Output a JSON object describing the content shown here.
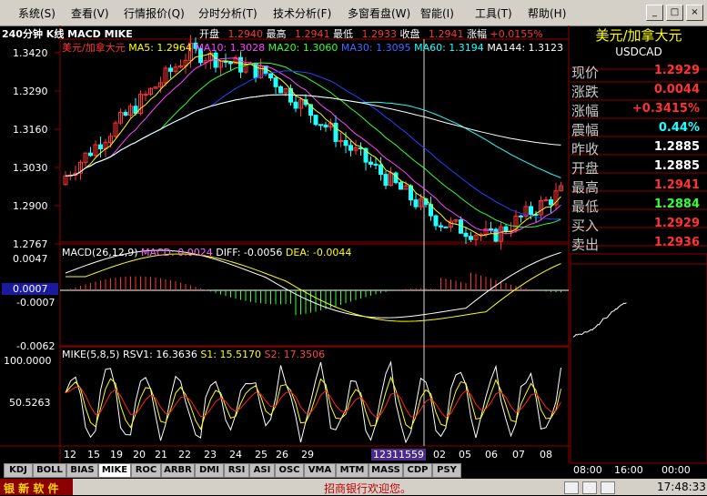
{
  "menu": [
    {
      "label": "系统(S)"
    },
    {
      "label": "查看(V)"
    },
    {
      "label": "行情报价(Q)"
    },
    {
      "label": "分时分析(T)"
    },
    {
      "label": "技术分析(F)"
    },
    {
      "label": "多窗看盘(W)"
    },
    {
      "label": "智能(I)"
    },
    {
      "label": "工具(T)"
    },
    {
      "label": "帮助(H)"
    }
  ],
  "window_buttons": [
    "_",
    "□",
    "×"
  ],
  "header": {
    "period": "240分钟 K线 MACD MIKE",
    "open_label": "开盘",
    "open": "1.2940",
    "high_label": "最高",
    "high": "1.2941",
    "low_label": "最低",
    "low": "1.2933",
    "close_label": "收盘",
    "close": "1.2941",
    "change_label": "涨幅",
    "change": "+0.0155%"
  },
  "kline": {
    "name": "美元/加拿大元",
    "ma": [
      {
        "label": "MA5: 1.2964",
        "color": "#ffff00"
      },
      {
        "label": "MA10: 1.3028",
        "color": "#ff44ff"
      },
      {
        "label": "MA20: 1.3060",
        "color": "#33ff33"
      },
      {
        "label": "MA30: 1.3095",
        "color": "#2244ff"
      },
      {
        "label": "MA60: 1.3194",
        "color": "#22ffff"
      },
      {
        "label": "MA144: 1.3123",
        "color": "#ffffff"
      }
    ],
    "yticks": [
      "1.3420",
      "1.3290",
      "1.3160",
      "1.3030",
      "1.2900",
      "1.2767"
    ]
  },
  "macd": {
    "title": "MACD(26,12,9)",
    "values": [
      {
        "label": "MACD: 0.0024",
        "color": "#ff66ff"
      },
      {
        "label": "DIFF: -0.0056",
        "color": "#ffffff"
      },
      {
        "label": "DEA: -0.0044",
        "color": "#ffff00"
      }
    ],
    "yticks": [
      "0.0047",
      "0.0007",
      "-0.0007",
      "-0.0062"
    ]
  },
  "mike": {
    "title": "MIKE(5,8,5)",
    "values": [
      {
        "label": "RSV1: 16.3636",
        "color": "#ffffff"
      },
      {
        "label": "S1: 15.5170",
        "color": "#ffff00"
      },
      {
        "label": "S2: 17.3506",
        "color": "#ff4444"
      }
    ],
    "yticks": [
      "100.0000",
      "50.5263"
    ]
  },
  "xaxis": [
    "12",
    "15",
    "19",
    "20",
    "21",
    "22",
    "23",
    "24",
    "25",
    "26",
    "29",
    "12311559",
    "02",
    "05",
    "06",
    "07",
    "08"
  ],
  "tabs": [
    "KDJ",
    "BOLL",
    "BIAS",
    "MIKE",
    "ROC",
    "ARBR",
    "DMI",
    "RSI",
    "ASI",
    "OSC",
    "VMA",
    "MTM",
    "MASS",
    "CDP",
    "PSY"
  ],
  "active_tab": "MIKE",
  "quote": {
    "title": "美元/加拿大元",
    "code": "USDCAD",
    "rows": [
      {
        "label": "现价",
        "value": "1.2929",
        "color": "#ff3333"
      },
      {
        "label": "涨跌",
        "value": "0.0044",
        "color": "#ff3333"
      },
      {
        "label": "涨幅",
        "value": "+0.3415%",
        "color": "#ff3333"
      },
      {
        "label": "震幅",
        "value": "0.44%",
        "color": "#22ffff"
      },
      {
        "label": "昨收",
        "value": "1.2885",
        "color": "#ffffff"
      },
      {
        "label": "开盘",
        "value": "1.2885",
        "color": "#ffffff"
      },
      {
        "label": "最高",
        "value": "1.2941",
        "color": "#ff3333"
      },
      {
        "label": "最低",
        "value": "1.2884",
        "color": "#33ff33"
      },
      {
        "label": "买入",
        "value": "1.2929",
        "color": "#ff3333"
      },
      {
        "label": "卖出",
        "value": "1.2936",
        "color": "#ff3333"
      }
    ],
    "time_axis": [
      "08:00",
      "16:00",
      "00:00"
    ]
  },
  "status": {
    "logo": "银 新 软 件",
    "ticker": "招商银行欢迎您。",
    "time": "17:48:33"
  },
  "colors": {
    "up": "#ff3333",
    "down": "#22ffff",
    "grid": "#8b0000"
  }
}
